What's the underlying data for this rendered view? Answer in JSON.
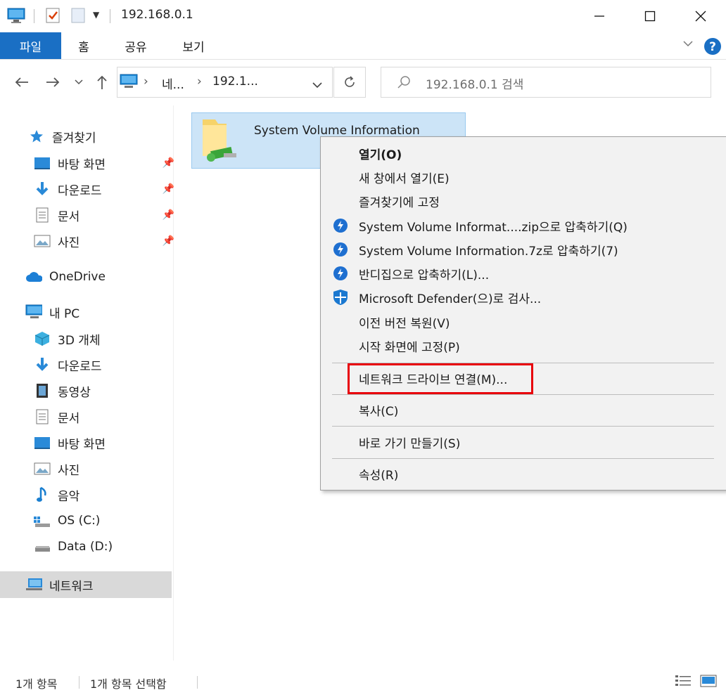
{
  "window": {
    "title": "192.168.0.1"
  },
  "ribbon": {
    "tabs": [
      "파일",
      "홈",
      "공유",
      "보기"
    ]
  },
  "address": {
    "crumbs": [
      "네...",
      "192.1..."
    ],
    "search_placeholder": "192.168.0.1 검색"
  },
  "nav": {
    "quick_access": "즐겨찾기",
    "quick_items": [
      {
        "label": "바탕 화면",
        "icon": "desktop-icon"
      },
      {
        "label": "다운로드",
        "icon": "download-icon"
      },
      {
        "label": "문서",
        "icon": "document-icon"
      },
      {
        "label": "사진",
        "icon": "picture-icon"
      }
    ],
    "onedrive": "OneDrive",
    "this_pc": "내 PC",
    "pc_items": [
      {
        "label": "3D 개체",
        "icon": "3d-objects-icon"
      },
      {
        "label": "다운로드",
        "icon": "download-icon"
      },
      {
        "label": "동영상",
        "icon": "video-icon"
      },
      {
        "label": "문서",
        "icon": "document-icon"
      },
      {
        "label": "바탕 화면",
        "icon": "desktop-icon"
      },
      {
        "label": "사진",
        "icon": "picture-icon"
      },
      {
        "label": "음악",
        "icon": "music-icon"
      },
      {
        "label": "OS (C:)",
        "icon": "os-drive-icon"
      },
      {
        "label": "Data (D:)",
        "icon": "drive-icon"
      }
    ],
    "network": "네트워크"
  },
  "content": {
    "folder_name": "System Volume Information"
  },
  "context_menu": {
    "items": [
      {
        "label": "열기(O)",
        "bold": true
      },
      {
        "label": "새 창에서 열기(E)"
      },
      {
        "label": "즐겨찾기에 고정"
      },
      {
        "label": "System Volume Informat....zip으로 압축하기(Q)",
        "icon": "bandizip-icon"
      },
      {
        "label": "System Volume Information.7z로 압축하기(7)",
        "icon": "bandizip-icon"
      },
      {
        "label": "반디집으로 압축하기(L)...",
        "icon": "bandizip-icon"
      },
      {
        "label": "Microsoft Defender(으)로 검사...",
        "icon": "defender-shield-icon"
      },
      {
        "label": "이전 버전 복원(V)"
      },
      {
        "label": "시작 화면에 고정(P)"
      },
      {
        "label": "네트워크 드라이브 연결(M)...",
        "highlighted": true
      },
      {
        "label": "복사(C)"
      },
      {
        "label": "바로 가기 만들기(S)"
      },
      {
        "label": "속성(R)"
      }
    ]
  },
  "status": {
    "count": "1개 항목",
    "selected": "1개 항목 선택함"
  },
  "colors": {
    "accent": "#1a6fc4",
    "selection": "#cce4f7",
    "highlight_box": "#e8000b"
  }
}
